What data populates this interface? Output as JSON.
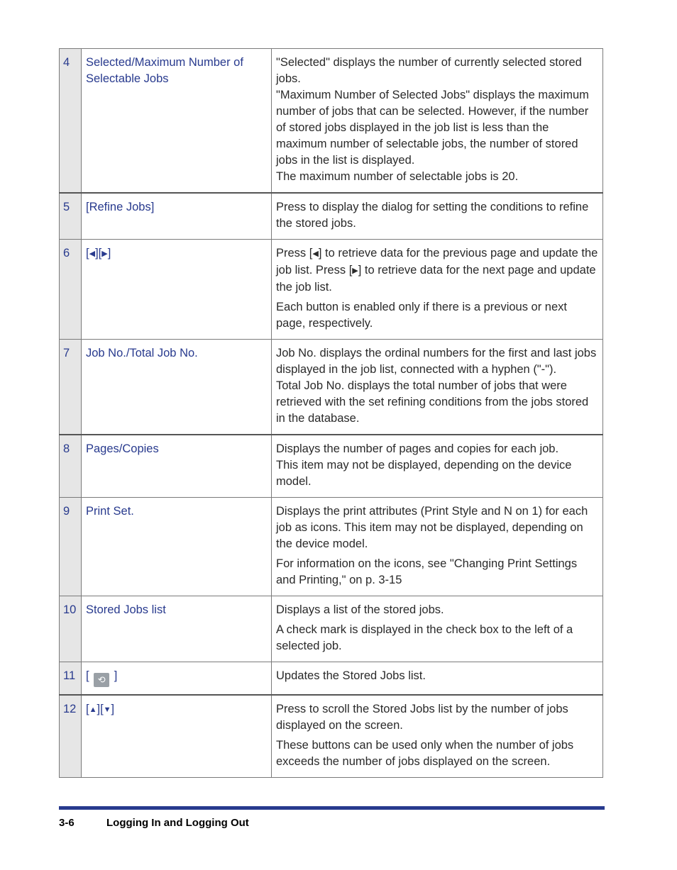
{
  "rows": [
    {
      "num": "4",
      "name": "Selected/Maximum Number of Selectable Jobs",
      "desc": [
        "\"Selected\" displays the number of currently selected stored jobs.",
        "\"Maximum Number of Selected Jobs\" displays the maximum number of jobs that can be selected. However, if the number of stored jobs displayed in the job list is less than the maximum number of selectable jobs, the number of stored jobs in the list is displayed.",
        "The maximum number of selectable jobs is 20."
      ]
    },
    {
      "num": "5",
      "name": "[Refine Jobs]",
      "desc": [
        "Press to display the dialog for setting the conditions to refine the stored jobs."
      ]
    },
    {
      "num": "6",
      "name_parts": [
        "[",
        "◀",
        "][",
        "▶",
        "]"
      ],
      "desc_parts": [
        "Press [",
        "◀",
        "] to retrieve data for the previous page and update the job list. Press [",
        "▶",
        "] to retrieve data for the next page and update the job list."
      ],
      "desc2": "Each button is enabled only if there is a previous or next page, respectively."
    },
    {
      "num": "7",
      "name": "Job No./Total Job No.",
      "desc": [
        "Job No. displays the ordinal numbers for the first and last jobs displayed in the job list, connected with a hyphen (\"-\").",
        "Total Job No. displays the total number of jobs that were retrieved with the set refining conditions from the jobs stored in the database."
      ]
    },
    {
      "num": "8",
      "name": "Pages/Copies",
      "desc": [
        "Displays the number of pages and copies for each job.",
        "This item may not be displayed, depending on the device model."
      ]
    },
    {
      "num": "9",
      "name": "Print Set.",
      "desc": [
        "Displays the print attributes (Print Style and N on 1) for each job as icons. This item may not be displayed, depending on the device model.",
        "For information on the icons, see \"Changing Print Settings and Printing,\" on p. 3-15"
      ]
    },
    {
      "num": "10",
      "name": "Stored Jobs list",
      "desc": [
        "Displays a list of the stored jobs.",
        "A check mark is displayed in the check box to the left of a selected job."
      ]
    },
    {
      "num": "11",
      "name_parts": [
        "[",
        "⟲",
        "]"
      ],
      "desc": [
        "Updates the Stored Jobs list."
      ]
    },
    {
      "num": "12",
      "name_parts": [
        "[",
        "▲",
        "][",
        "▼",
        "]"
      ],
      "desc": [
        "Press to scroll the Stored Jobs list by the number of jobs displayed on the screen.",
        "These buttons can be used only when the number of jobs exceeds the number of jobs displayed on the screen."
      ]
    }
  ],
  "footer": {
    "page": "3-6",
    "title": "Logging In and Logging Out"
  }
}
